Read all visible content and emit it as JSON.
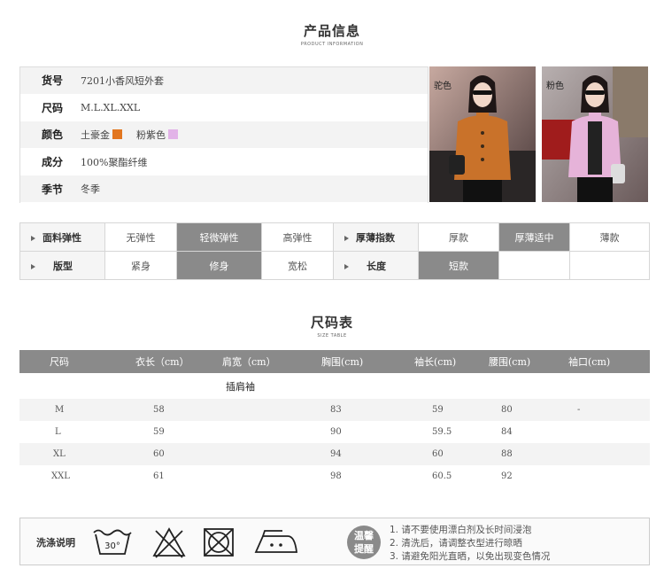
{
  "product_info": {
    "title_cn": "产品信息",
    "title_en": "PRODUCT INFORMATION",
    "rows": [
      {
        "label": "货号",
        "value": "7201小香风短外套"
      },
      {
        "label": "尺码",
        "value": "M.L.XL.XXL"
      },
      {
        "label": "颜色",
        "value": ""
      },
      {
        "label": "成分",
        "value": "100%聚酯纤维"
      },
      {
        "label": "季节",
        "value": "冬季"
      }
    ],
    "colors": [
      {
        "name": "土豪金",
        "hex": "#e2761f"
      },
      {
        "name": "粉紫色",
        "hex": "#e2b3e8"
      }
    ],
    "photos": [
      {
        "label": "驼色",
        "coat": "#c9722a"
      },
      {
        "label": "粉色",
        "coat": "#e6b3d9"
      }
    ]
  },
  "attributes": {
    "row1": {
      "label1": "面料弹性",
      "options1": [
        "无弹性",
        "轻微弹性",
        "高弹性"
      ],
      "selected1": 1,
      "label2": "厚薄指数",
      "options2": [
        "厚款",
        "厚薄适中",
        "薄款"
      ],
      "selected2": 1
    },
    "row2": {
      "label1": "版型",
      "options1": [
        "紧身",
        "修身",
        "宽松"
      ],
      "selected1": 1,
      "label2": "长度",
      "options2": [
        "短款",
        "",
        ""
      ],
      "selected2": 0
    }
  },
  "size_chart": {
    "title_cn": "尺码表",
    "title_en": "SIZE TABLE",
    "headers": [
      "尺码",
      "衣长（cm）",
      "肩宽（cm）",
      "胸围(cm)",
      "袖长(cm)",
      "腰围(cm)",
      "袖口(cm)"
    ],
    "note": "插肩袖",
    "rows": [
      [
        "M",
        "58",
        "",
        "83",
        "59",
        "80",
        "-"
      ],
      [
        "L",
        "59",
        "",
        "90",
        "59.5",
        "84",
        ""
      ],
      [
        "XL",
        "60",
        "",
        "94",
        "60",
        "88",
        ""
      ],
      [
        "XXL",
        "61",
        "",
        "98",
        "60.5",
        "92",
        ""
      ]
    ]
  },
  "care": {
    "label": "洗涤说明",
    "wash_temp": "30°",
    "tip_badge_line1": "温馨",
    "tip_badge_line2": "提醒",
    "tips": [
      "1. 请不要使用漂白剂及长时间浸泡",
      "2. 清洗后，请调整衣型进行晾晒",
      "3. 请避免阳光直晒，以免出现变色情况"
    ]
  }
}
